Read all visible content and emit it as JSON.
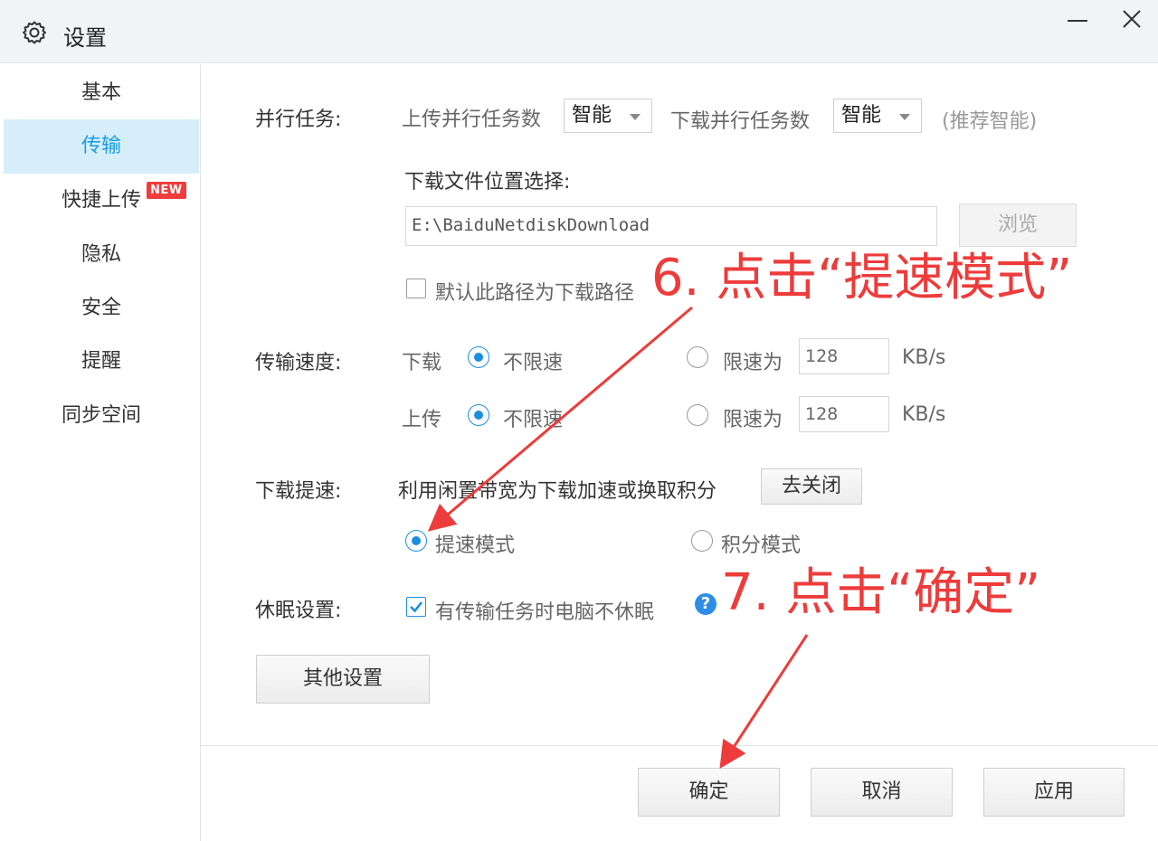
{
  "window": {
    "title": "设置"
  },
  "sidebar": {
    "items": [
      {
        "label": "基本"
      },
      {
        "label": "传输"
      },
      {
        "label": "快捷上传"
      },
      {
        "label": "隐私"
      },
      {
        "label": "安全"
      },
      {
        "label": "提醒"
      },
      {
        "label": "同步空间"
      }
    ],
    "active_index": 1,
    "new_badge": "NEW"
  },
  "parallel": {
    "label": "并行任务:",
    "upload_label": "上传并行任务数",
    "upload_value": "智能",
    "download_label": "下载并行任务数",
    "download_value": "智能",
    "hint": "(推荐智能)"
  },
  "download_location": {
    "label": "下载文件位置选择:",
    "path": "E:\\BaiduNetdiskDownload",
    "browse_label": "浏览",
    "default_checkbox_label": "默认此路径为下载路径",
    "default_checked": false
  },
  "speed": {
    "label": "传输速度:",
    "download": {
      "label": "下载",
      "unlimited_label": "不限速",
      "limit_label": "限速为",
      "limit_value": "128",
      "unit": "KB/s",
      "mode": "unlimited"
    },
    "upload": {
      "label": "上传",
      "unlimited_label": "不限速",
      "limit_label": "限速为",
      "limit_value": "128",
      "unit": "KB/s",
      "mode": "unlimited"
    }
  },
  "accelerate": {
    "label": "下载提速:",
    "description": "利用闲置带宽为下载加速或换取积分",
    "close_button": "去关闭",
    "speed_mode_label": "提速模式",
    "points_mode_label": "积分模式",
    "selected": "speed_mode"
  },
  "sleep": {
    "label": "休眠设置:",
    "checkbox_label": "有传输任务时电脑不休眠",
    "checked": true,
    "help_icon": "?"
  },
  "other_settings_button": "其他设置",
  "footer": {
    "ok": "确定",
    "cancel": "取消",
    "apply": "应用"
  },
  "annotations": {
    "step6": "6. 点击“提速模式”",
    "step7": "7. 点击“确定”",
    "color": "#ee3b3b"
  },
  "colors": {
    "accent": "#1a8fe0",
    "active_bg": "#d6eefa",
    "badge": "#f03c3c"
  }
}
